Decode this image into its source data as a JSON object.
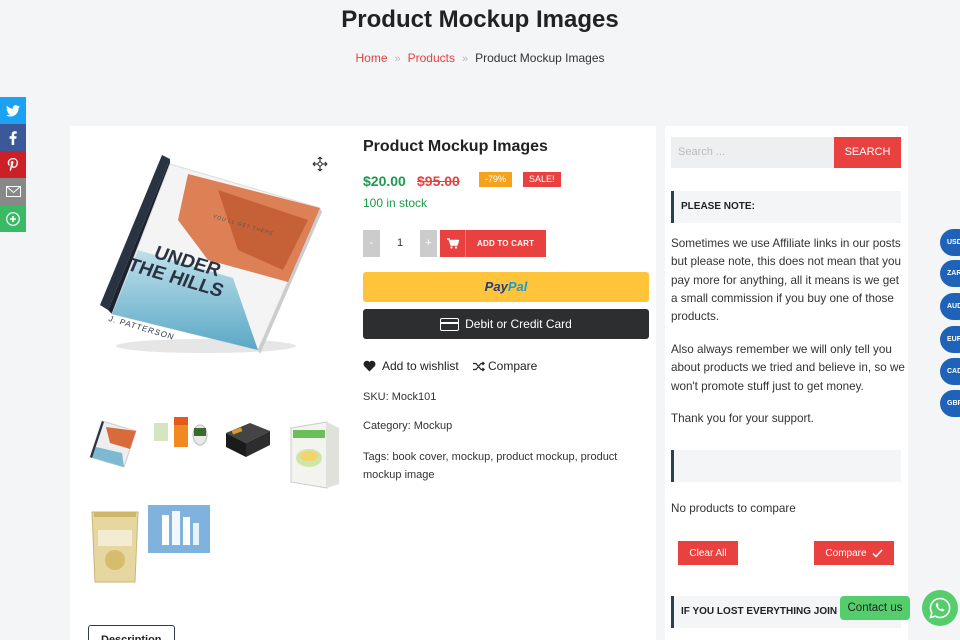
{
  "header": {
    "title": "Product Mockup Images",
    "breadcrumb": {
      "home": "Home",
      "products": "Products",
      "current": "Product Mockup Images",
      "separator": "»"
    }
  },
  "share_icons": [
    {
      "name": "twitter-icon",
      "color": "#1da1f2"
    },
    {
      "name": "facebook-icon",
      "color": "#3b5998"
    },
    {
      "name": "pinterest-icon",
      "color": "#cb2027"
    },
    {
      "name": "email-icon",
      "color": "#888888"
    },
    {
      "name": "more-share-icon",
      "color": "#3bba66"
    }
  ],
  "product": {
    "title": "Product Mockup Images",
    "price": "$20.00",
    "old_price": "$95.00",
    "discount": "-79%",
    "sale": "SALE!",
    "stock": "100 in stock",
    "qty_minus": "-",
    "qty_value": "1",
    "qty_plus": "+",
    "add_to_cart": "ADD TO CART",
    "paypal_a": "Pay",
    "paypal_b": "Pal",
    "debit_card": "Debit or Credit Card",
    "wishlist": "Add to wishlist",
    "compare": "Compare",
    "sku_label": "SKU:",
    "sku": "Mock101",
    "category_label": "Category:",
    "category": "Mockup",
    "tags_label": "Tags:",
    "tags": "book cover, mockup, product mockup, product mockup image",
    "description_tab": "Description",
    "book_top": "YOU'LL GET THERE",
    "book_title_1": "UNDER",
    "book_title_2": "THE HILLS",
    "book_author": "J. PATTERSON"
  },
  "sidebar": {
    "search_placeholder": "Search ...",
    "search_button": "SEARCH",
    "please_note_title": "PLEASE NOTE:",
    "note_p1": "Sometimes we use Affiliate links in our posts but please note, this does not mean that you pay more for anything, all it means is we get a small commission if you buy one of those products.",
    "note_p2": "Also always remember we will only tell you about products we tried and believe in, so we won't promote stuff just to get money.",
    "note_p3": "Thank you for your support.",
    "compare_empty": "No products to compare",
    "clear_all": "Clear All",
    "compare_button": "Compare",
    "lost_title": "IF YOU LOST EVERYTHING JOIN"
  },
  "currencies": [
    "USD",
    "ZAR",
    "AUD",
    "EUR",
    "CAD",
    "GBP"
  ],
  "contact_label": "Contact us",
  "colors": {
    "accent": "#e8413f",
    "price": "#1a9a4a",
    "navy": "#2c3e50",
    "whatsapp": "#55cd6c",
    "currency": "#1e63b8"
  }
}
